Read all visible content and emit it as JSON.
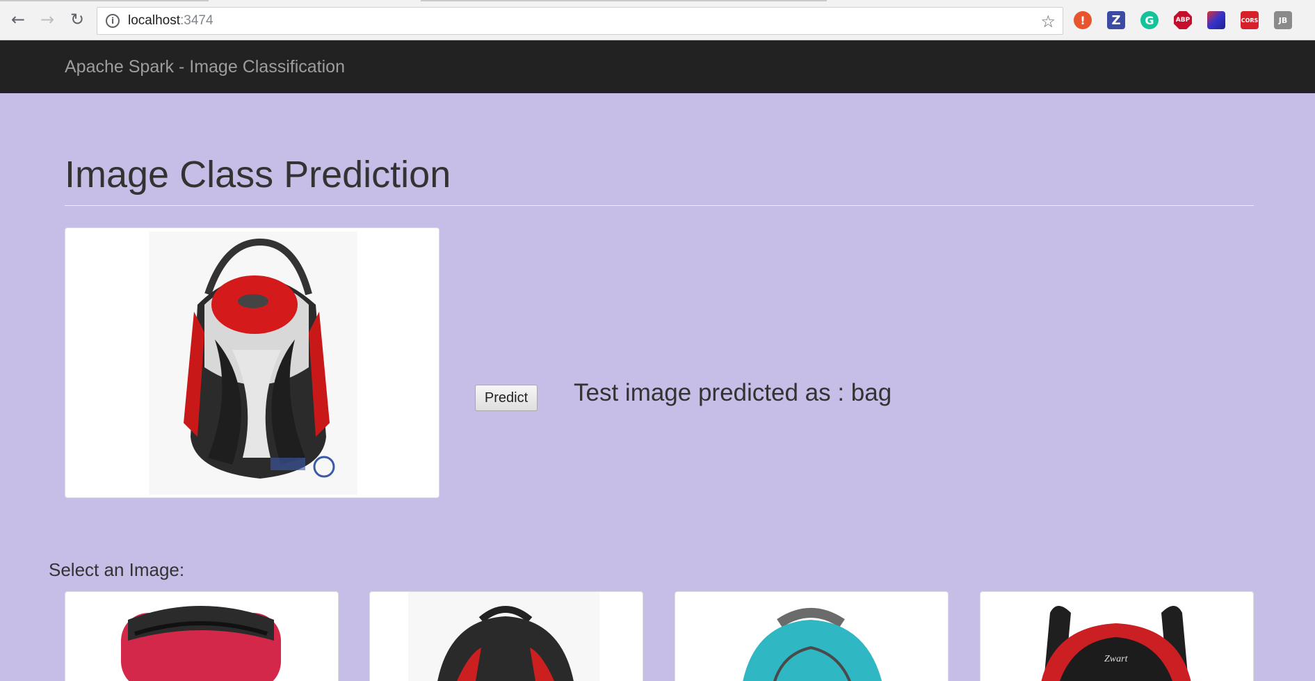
{
  "browser": {
    "url_host": "localhost",
    "url_port": ":3474"
  },
  "navbar": {
    "brand": "Apache Spark - Image Classification"
  },
  "main": {
    "title": "Image Class Prediction",
    "predict_button": "Predict",
    "result_text": "Test image predicted as : bag",
    "select_label": "Select an Image:"
  },
  "extensions": [
    {
      "label": "!",
      "color": "#e8552d"
    },
    {
      "label": "Z",
      "color": "#3b4ba4"
    },
    {
      "label": "G",
      "color": "#15c39a"
    },
    {
      "label": "ABP",
      "color": "#c70d2c"
    },
    {
      "label": "",
      "color": "#3c3c8c"
    },
    {
      "label": "CORS",
      "color": "#d6202a"
    },
    {
      "label": "JB",
      "color": "#8a8a8a"
    }
  ],
  "icons": [
    "back-arrow-icon",
    "forward-arrow-icon",
    "reload-icon",
    "info-icon",
    "star-icon"
  ]
}
